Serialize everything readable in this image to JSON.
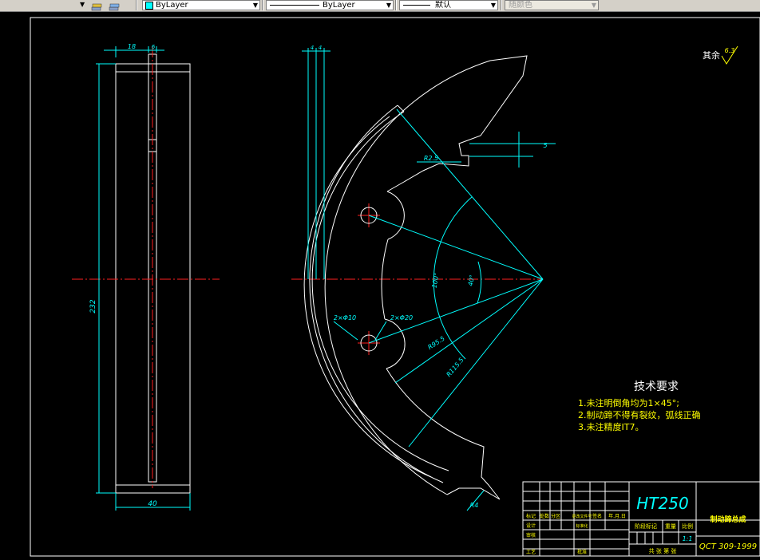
{
  "toolbar": {
    "color_control": "ByLayer",
    "linetype_control": "ByLayer",
    "lineweight_control": "默认",
    "plotstyle_control": "随颜色"
  },
  "drawing": {
    "surface_roughness": "其余",
    "roughness_value": "6.3",
    "dims": {
      "w18": "18",
      "w6": "6",
      "h232": "232",
      "w40": "40",
      "t4a": "4",
      "t4b": "4",
      "r25": "R2.5",
      "d5": "5",
      "a100": "100°",
      "a40": "40°",
      "holes10": "2×Φ10",
      "holes20": "2×Φ20",
      "r955": "R95.5",
      "r1155": "R115.5",
      "r4": "R4"
    },
    "tech_title": "技术要求",
    "tech_notes": [
      "1.未注明倒角均为1×45°;",
      "2.制动蹄不得有裂纹，弧线正确",
      "3.未注精度IT7。"
    ]
  },
  "title_block": {
    "material": "HT250",
    "part_name": "制动蹄总成",
    "standard": "QCT 309-1999",
    "scale": "1:1",
    "col_stage": "阶段标记",
    "col_weight": "重量",
    "col_scale": "比例",
    "sheet_info": "共 张 第 张",
    "row_labels": [
      "标记",
      "处数",
      "分区",
      "更改文件号",
      "签名",
      "年.月.日"
    ],
    "side_labels": [
      "设计",
      "标准化",
      "审核",
      "工艺",
      "批准"
    ]
  }
}
